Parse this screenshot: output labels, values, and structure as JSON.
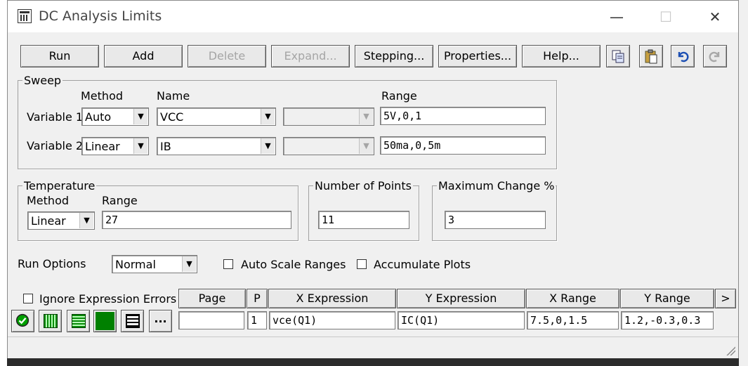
{
  "window": {
    "title": "DC Analysis Limits"
  },
  "window_controls": {
    "minimize": "—",
    "maximize": "☐",
    "close": "✕"
  },
  "toolbar": {
    "run": "Run",
    "add": "Add",
    "delete": "Delete",
    "expand": "Expand...",
    "stepping": "Stepping...",
    "properties": "Properties...",
    "help": "Help..."
  },
  "sweep": {
    "legend": "Sweep",
    "method_header": "Method",
    "name_header": "Name",
    "range_header": "Range",
    "variables": [
      {
        "label": "Variable 1",
        "method": "Auto",
        "name": "VCC",
        "range": "5V,0,1"
      },
      {
        "label": "Variable 2",
        "method": "Linear",
        "name": "IB",
        "range": "50ma,0,5m"
      }
    ]
  },
  "temperature": {
    "legend": "Temperature",
    "method_header": "Method",
    "range_header": "Range",
    "method": "Linear",
    "range": "27"
  },
  "points": {
    "legend": "Number of Points",
    "value": "11"
  },
  "max_change": {
    "legend": "Maximum Change %",
    "value": "3"
  },
  "run_options": {
    "label": "Run Options",
    "value": "Normal"
  },
  "checkboxes": {
    "auto_scale": "Auto Scale Ranges",
    "accumulate": "Accumulate Plots",
    "ignore_errors": "Ignore Expression Errors"
  },
  "columns": {
    "page": "Page",
    "p": "P",
    "x_expression": "X Expression",
    "y_expression": "Y Expression",
    "x_range": "X Range",
    "y_range": "Y Range",
    "more": ">"
  },
  "row": {
    "more_button": "...",
    "page": "",
    "p": "1",
    "x_expression": "vce(Q1)",
    "y_expression": "IC(Q1)",
    "x_range": "7.5,0,1.5",
    "y_range": "1.2,-0.3,0.3"
  },
  "colors": {
    "plot_color": "#008000",
    "check_green": "#008000"
  }
}
